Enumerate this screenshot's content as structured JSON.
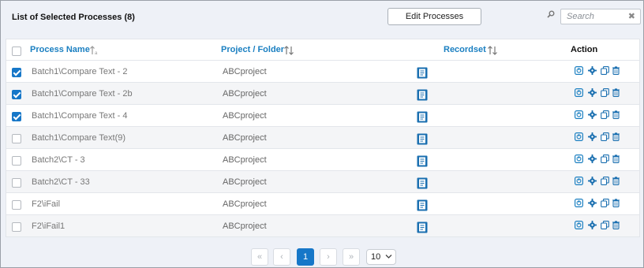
{
  "header": {
    "title": "List of Selected Processes (8)",
    "edit_button": "Edit Processes",
    "search_placeholder": "Search",
    "search_clear": "✖"
  },
  "table": {
    "columns": {
      "name": "Process Name",
      "project": "Project / Folder",
      "recordset": "Recordset",
      "action": "Action"
    },
    "rows": [
      {
        "name": "Batch1\\Compare Text - 2",
        "project": "ABCproject",
        "checked": true
      },
      {
        "name": "Batch1\\Compare Text - 2b",
        "project": "ABCproject",
        "checked": true
      },
      {
        "name": "Batch1\\Compare Text - 4",
        "project": "ABCproject",
        "checked": true
      },
      {
        "name": "Batch1\\Compare Text(9)",
        "project": "ABCproject",
        "checked": false
      },
      {
        "name": "Batch2\\CT - 3",
        "project": "ABCproject",
        "checked": false
      },
      {
        "name": "Batch2\\CT - 33",
        "project": "ABCproject",
        "checked": false
      },
      {
        "name": "F2\\iFail",
        "project": "ABCproject",
        "checked": false
      },
      {
        "name": "F2\\iFail1",
        "project": "ABCproject",
        "checked": false
      }
    ]
  },
  "pagination": {
    "first": "«",
    "prev": "‹",
    "current_page": "1",
    "next": "›",
    "last": "»",
    "page_size": "10"
  },
  "colors": {
    "accent": "#1677c8",
    "header_link": "#1a7fc1",
    "icon_blue": "#1a6fb0"
  }
}
